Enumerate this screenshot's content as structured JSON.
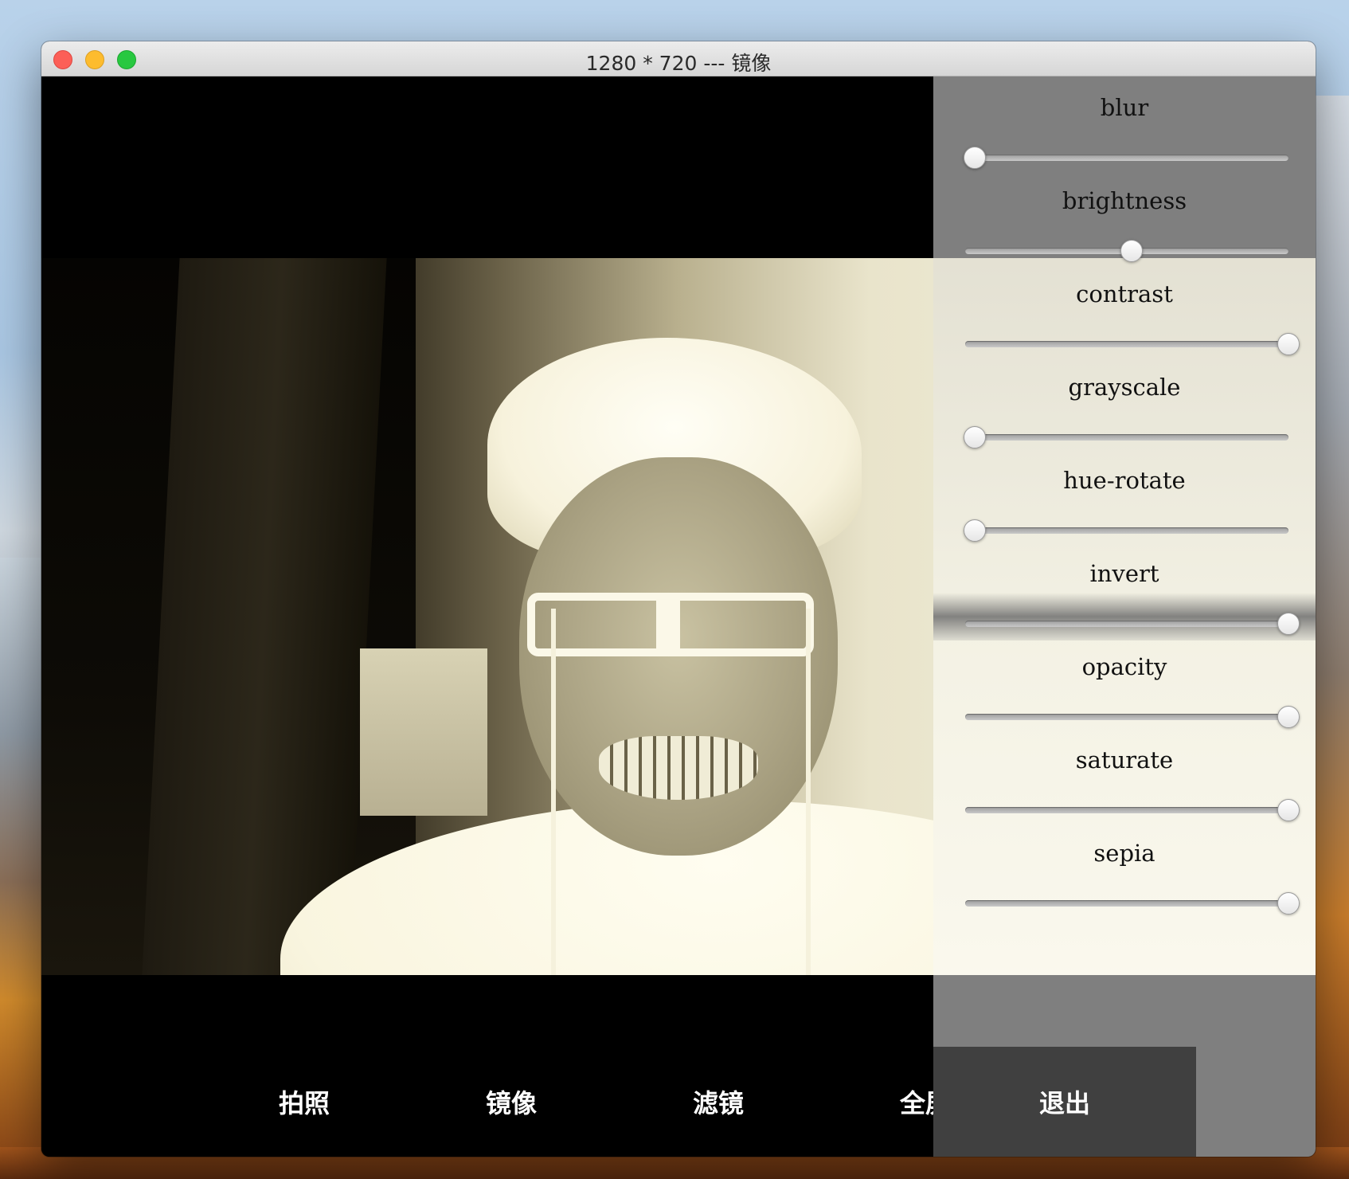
{
  "window": {
    "title": "1280 * 720 --- 镜像"
  },
  "panel": {
    "controls": [
      {
        "label": "blur",
        "value": 0.0
      },
      {
        "label": "brightness",
        "value": 0.5
      },
      {
        "label": "contrast",
        "value": 1.0
      },
      {
        "label": "grayscale",
        "value": 0.0
      },
      {
        "label": "hue-rotate",
        "value": 0.0
      },
      {
        "label": "invert",
        "value": 1.0
      },
      {
        "label": "opacity",
        "value": 1.0
      },
      {
        "label": "saturate",
        "value": 1.0
      },
      {
        "label": "sepia",
        "value": 1.0
      }
    ]
  },
  "buttons": {
    "photo": "拍照",
    "mirror": "镜像",
    "filter": "滤镜",
    "fullscreen": "全屏",
    "exit": "退出"
  },
  "colors": {
    "panel_bg": "#7f7f7f",
    "exit_bg": "#404040",
    "button_text": "#ffffff"
  }
}
